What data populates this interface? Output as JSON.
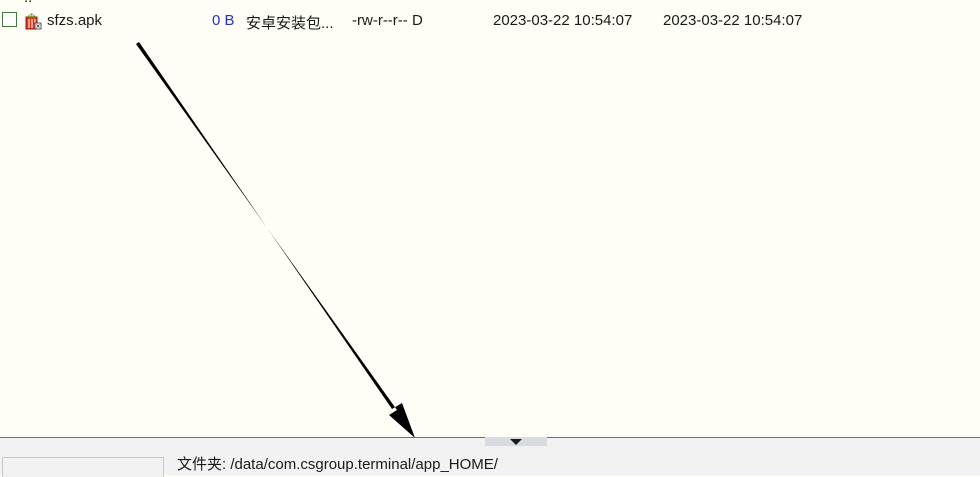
{
  "file_list": {
    "parent_row": {
      "label": ".."
    },
    "files": [
      {
        "name": "sfzs.apk",
        "size": "0 B",
        "type": "安卓安装包...",
        "permissions": "-rw-r--r-- D",
        "modified": "2023-03-22 10:54:07",
        "created": "2023-03-22 10:54:07",
        "icon": "apk-file-icon"
      }
    ]
  },
  "status_bar": {
    "path_text": "文件夹: /data/com.csgroup.terminal/app_HOME/"
  },
  "colors": {
    "list_background": "#fefef6",
    "size_text": "#2233cc",
    "status_bar_background": "#f2f2f2",
    "annotation_arrow": "#000000"
  }
}
